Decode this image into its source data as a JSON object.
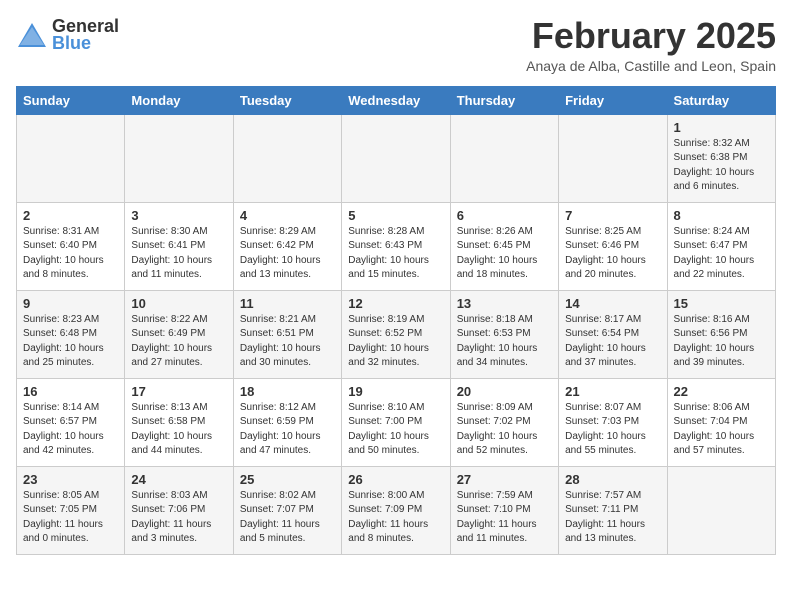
{
  "header": {
    "logo_general": "General",
    "logo_blue": "Blue",
    "month_title": "February 2025",
    "location": "Anaya de Alba, Castille and Leon, Spain"
  },
  "days_of_week": [
    "Sunday",
    "Monday",
    "Tuesday",
    "Wednesday",
    "Thursday",
    "Friday",
    "Saturday"
  ],
  "weeks": [
    [
      {
        "day": "",
        "info": ""
      },
      {
        "day": "",
        "info": ""
      },
      {
        "day": "",
        "info": ""
      },
      {
        "day": "",
        "info": ""
      },
      {
        "day": "",
        "info": ""
      },
      {
        "day": "",
        "info": ""
      },
      {
        "day": "1",
        "info": "Sunrise: 8:32 AM\nSunset: 6:38 PM\nDaylight: 10 hours and 6 minutes."
      }
    ],
    [
      {
        "day": "2",
        "info": "Sunrise: 8:31 AM\nSunset: 6:40 PM\nDaylight: 10 hours and 8 minutes."
      },
      {
        "day": "3",
        "info": "Sunrise: 8:30 AM\nSunset: 6:41 PM\nDaylight: 10 hours and 11 minutes."
      },
      {
        "day": "4",
        "info": "Sunrise: 8:29 AM\nSunset: 6:42 PM\nDaylight: 10 hours and 13 minutes."
      },
      {
        "day": "5",
        "info": "Sunrise: 8:28 AM\nSunset: 6:43 PM\nDaylight: 10 hours and 15 minutes."
      },
      {
        "day": "6",
        "info": "Sunrise: 8:26 AM\nSunset: 6:45 PM\nDaylight: 10 hours and 18 minutes."
      },
      {
        "day": "7",
        "info": "Sunrise: 8:25 AM\nSunset: 6:46 PM\nDaylight: 10 hours and 20 minutes."
      },
      {
        "day": "8",
        "info": "Sunrise: 8:24 AM\nSunset: 6:47 PM\nDaylight: 10 hours and 22 minutes."
      }
    ],
    [
      {
        "day": "9",
        "info": "Sunrise: 8:23 AM\nSunset: 6:48 PM\nDaylight: 10 hours and 25 minutes."
      },
      {
        "day": "10",
        "info": "Sunrise: 8:22 AM\nSunset: 6:49 PM\nDaylight: 10 hours and 27 minutes."
      },
      {
        "day": "11",
        "info": "Sunrise: 8:21 AM\nSunset: 6:51 PM\nDaylight: 10 hours and 30 minutes."
      },
      {
        "day": "12",
        "info": "Sunrise: 8:19 AM\nSunset: 6:52 PM\nDaylight: 10 hours and 32 minutes."
      },
      {
        "day": "13",
        "info": "Sunrise: 8:18 AM\nSunset: 6:53 PM\nDaylight: 10 hours and 34 minutes."
      },
      {
        "day": "14",
        "info": "Sunrise: 8:17 AM\nSunset: 6:54 PM\nDaylight: 10 hours and 37 minutes."
      },
      {
        "day": "15",
        "info": "Sunrise: 8:16 AM\nSunset: 6:56 PM\nDaylight: 10 hours and 39 minutes."
      }
    ],
    [
      {
        "day": "16",
        "info": "Sunrise: 8:14 AM\nSunset: 6:57 PM\nDaylight: 10 hours and 42 minutes."
      },
      {
        "day": "17",
        "info": "Sunrise: 8:13 AM\nSunset: 6:58 PM\nDaylight: 10 hours and 44 minutes."
      },
      {
        "day": "18",
        "info": "Sunrise: 8:12 AM\nSunset: 6:59 PM\nDaylight: 10 hours and 47 minutes."
      },
      {
        "day": "19",
        "info": "Sunrise: 8:10 AM\nSunset: 7:00 PM\nDaylight: 10 hours and 50 minutes."
      },
      {
        "day": "20",
        "info": "Sunrise: 8:09 AM\nSunset: 7:02 PM\nDaylight: 10 hours and 52 minutes."
      },
      {
        "day": "21",
        "info": "Sunrise: 8:07 AM\nSunset: 7:03 PM\nDaylight: 10 hours and 55 minutes."
      },
      {
        "day": "22",
        "info": "Sunrise: 8:06 AM\nSunset: 7:04 PM\nDaylight: 10 hours and 57 minutes."
      }
    ],
    [
      {
        "day": "23",
        "info": "Sunrise: 8:05 AM\nSunset: 7:05 PM\nDaylight: 11 hours and 0 minutes."
      },
      {
        "day": "24",
        "info": "Sunrise: 8:03 AM\nSunset: 7:06 PM\nDaylight: 11 hours and 3 minutes."
      },
      {
        "day": "25",
        "info": "Sunrise: 8:02 AM\nSunset: 7:07 PM\nDaylight: 11 hours and 5 minutes."
      },
      {
        "day": "26",
        "info": "Sunrise: 8:00 AM\nSunset: 7:09 PM\nDaylight: 11 hours and 8 minutes."
      },
      {
        "day": "27",
        "info": "Sunrise: 7:59 AM\nSunset: 7:10 PM\nDaylight: 11 hours and 11 minutes."
      },
      {
        "day": "28",
        "info": "Sunrise: 7:57 AM\nSunset: 7:11 PM\nDaylight: 11 hours and 13 minutes."
      },
      {
        "day": "",
        "info": ""
      }
    ]
  ]
}
